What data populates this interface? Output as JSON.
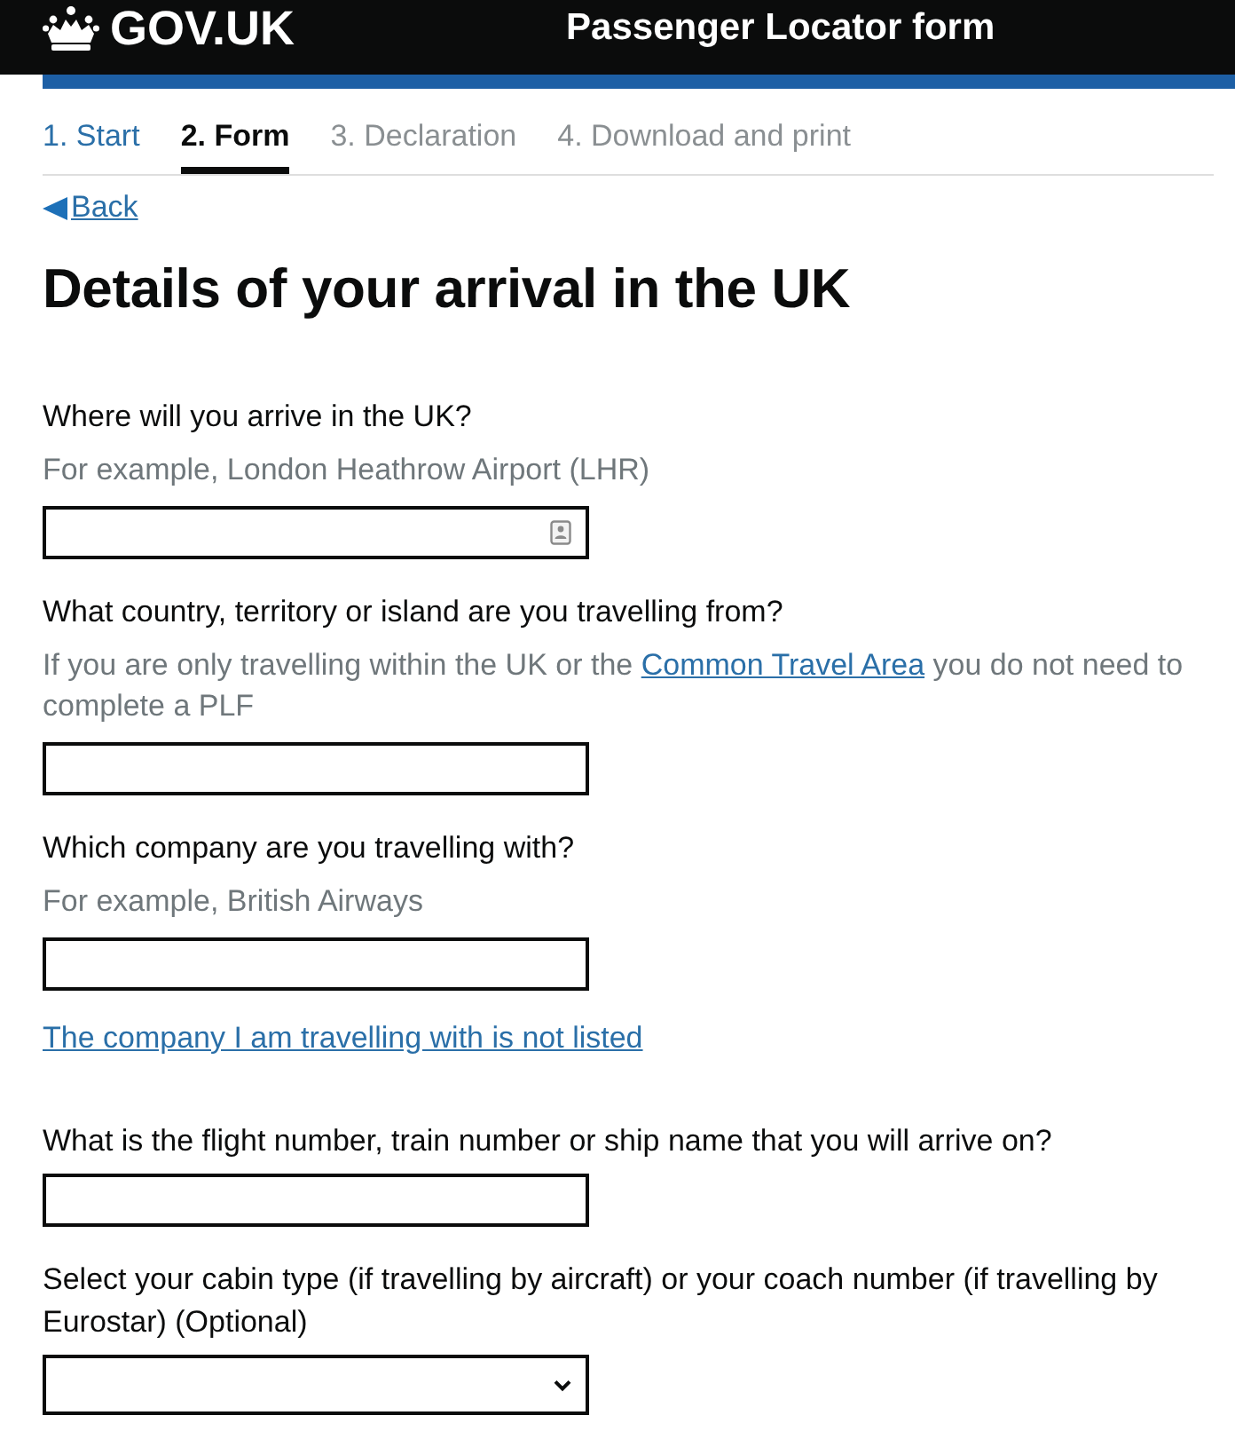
{
  "header": {
    "logo": "GOV.UK",
    "service": "Passenger Locator form"
  },
  "steps": [
    {
      "label": "1. Start",
      "selected": false,
      "visited": true
    },
    {
      "label": "2. Form",
      "selected": true,
      "visited": true
    },
    {
      "label": "3. Declaration",
      "selected": false,
      "visited": false
    },
    {
      "label": "4. Download and print",
      "selected": false,
      "visited": false
    }
  ],
  "back_link": "Back",
  "heading": "Details of your arrival in the UK",
  "questions": [
    {
      "kind": "text",
      "label": "Where will you arrive in the UK?",
      "hint": [
        {
          "kind": "text",
          "text": "For example, London Heathrow Airport (LHR)"
        }
      ],
      "autofill": true
    },
    {
      "kind": "text",
      "label": "What country, territory or island are you travelling from?",
      "hint": [
        {
          "kind": "text",
          "text": "If you are only travelling within the UK or the "
        },
        {
          "kind": "link",
          "text": "Common Travel Area"
        },
        {
          "kind": "text",
          "text": " you do not need to complete a PLF"
        }
      ],
      "autofill": false
    },
    {
      "kind": "text",
      "label": "Which company are you travelling with?",
      "hint": [
        {
          "kind": "text",
          "text": "For example, British Airways"
        }
      ],
      "autofill": false,
      "link": "The company I am travelling with is not listed"
    },
    {
      "kind": "text",
      "label": "What is the flight number, train number or ship name that you will arrive on?",
      "autofill": false
    },
    {
      "kind": "select",
      "label": "Select your cabin type (if travelling by aircraft) or your coach number (if travelling by Eurostar) (Optional)",
      "autofill": false
    }
  ]
}
